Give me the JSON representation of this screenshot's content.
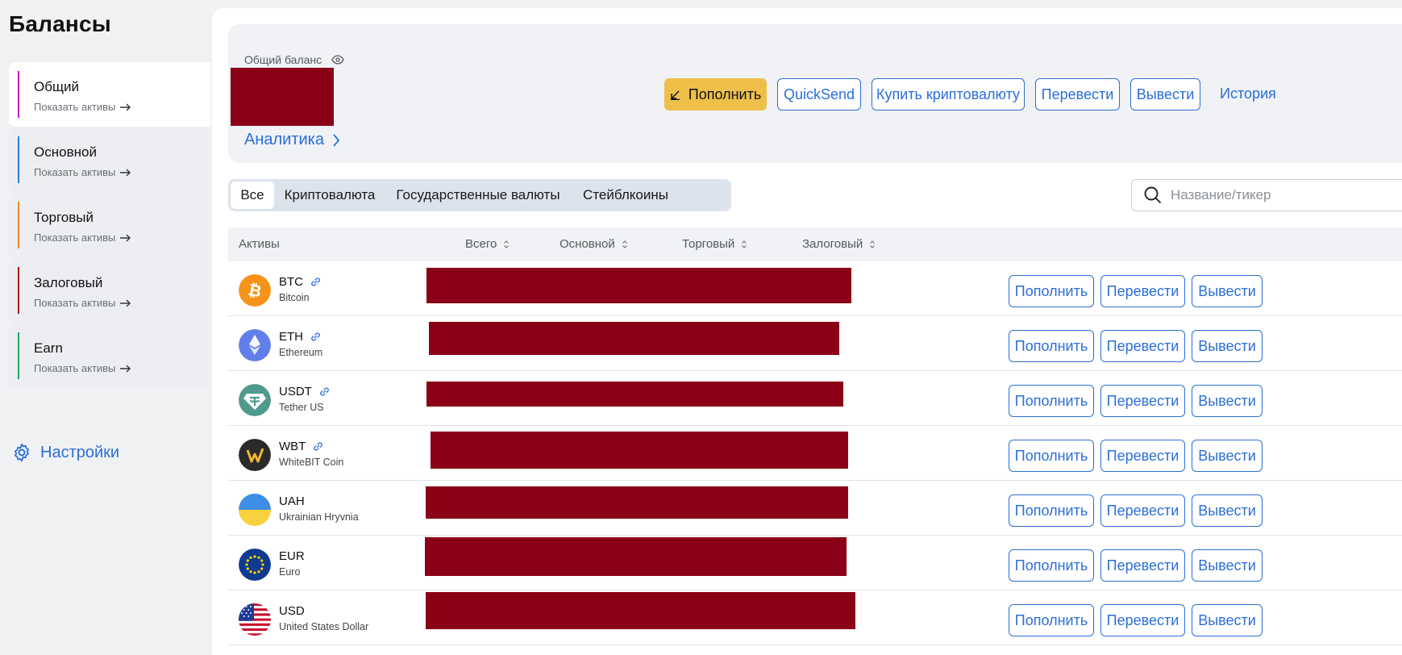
{
  "page": {
    "title": "Балансы"
  },
  "sidebar": {
    "items": [
      {
        "label": "Общий",
        "sub": "Показать активы",
        "color": "#c51fbf",
        "active": true
      },
      {
        "label": "Основной",
        "sub": "Показать активы",
        "color": "#2b7fd8"
      },
      {
        "label": "Торговый",
        "sub": "Показать активы",
        "color": "#ef8b2c"
      },
      {
        "label": "Залоговый",
        "sub": "Показать активы",
        "color": "#b3121f"
      },
      {
        "label": "Earn",
        "sub": "Показать активы",
        "color": "#1aa76b"
      }
    ],
    "settings_label": "Настройки"
  },
  "balance": {
    "label": "Общий баланс",
    "analytics_label": "Аналитика",
    "actions": {
      "deposit": "Пополнить",
      "quicksend": "QuickSend",
      "buy_crypto": "Купить криптовалюту",
      "transfer": "Перевести",
      "withdraw": "Вывести",
      "history": "История"
    }
  },
  "filters": {
    "tabs": [
      "Все",
      "Криптовалюта",
      "Государственные валюты",
      "Стейблкоины"
    ],
    "active": "Все",
    "search_placeholder": "Название/тикер"
  },
  "table": {
    "headers": {
      "assets": "Активы",
      "total": "Всего",
      "main": "Основной",
      "trading": "Торговый",
      "collateral": "Залоговый"
    },
    "row_actions": {
      "deposit": "Пополнить",
      "transfer": "Перевести",
      "withdraw": "Вывести"
    },
    "rows": [
      {
        "ticker": "BTC",
        "name": "Bitcoin",
        "icon": "bitcoin-icon",
        "linked": true
      },
      {
        "ticker": "ETH",
        "name": "Ethereum",
        "icon": "ethereum-icon",
        "linked": true
      },
      {
        "ticker": "USDT",
        "name": "Tether US",
        "icon": "tether-icon",
        "linked": true
      },
      {
        "ticker": "WBT",
        "name": "WhiteBIT Coin",
        "icon": "whitebit-icon",
        "linked": true
      },
      {
        "ticker": "UAH",
        "name": "Ukrainian Hryvnia",
        "icon": "ukraine-flag-icon",
        "linked": false
      },
      {
        "ticker": "EUR",
        "name": "Euro",
        "icon": "eu-flag-icon",
        "linked": false
      },
      {
        "ticker": "USD",
        "name": "United States Dollar",
        "icon": "us-flag-icon",
        "linked": false
      }
    ]
  },
  "colors": {
    "accent": "#2b6fd6",
    "deposit_button": "#eec04a",
    "redaction": "#8a0016"
  }
}
